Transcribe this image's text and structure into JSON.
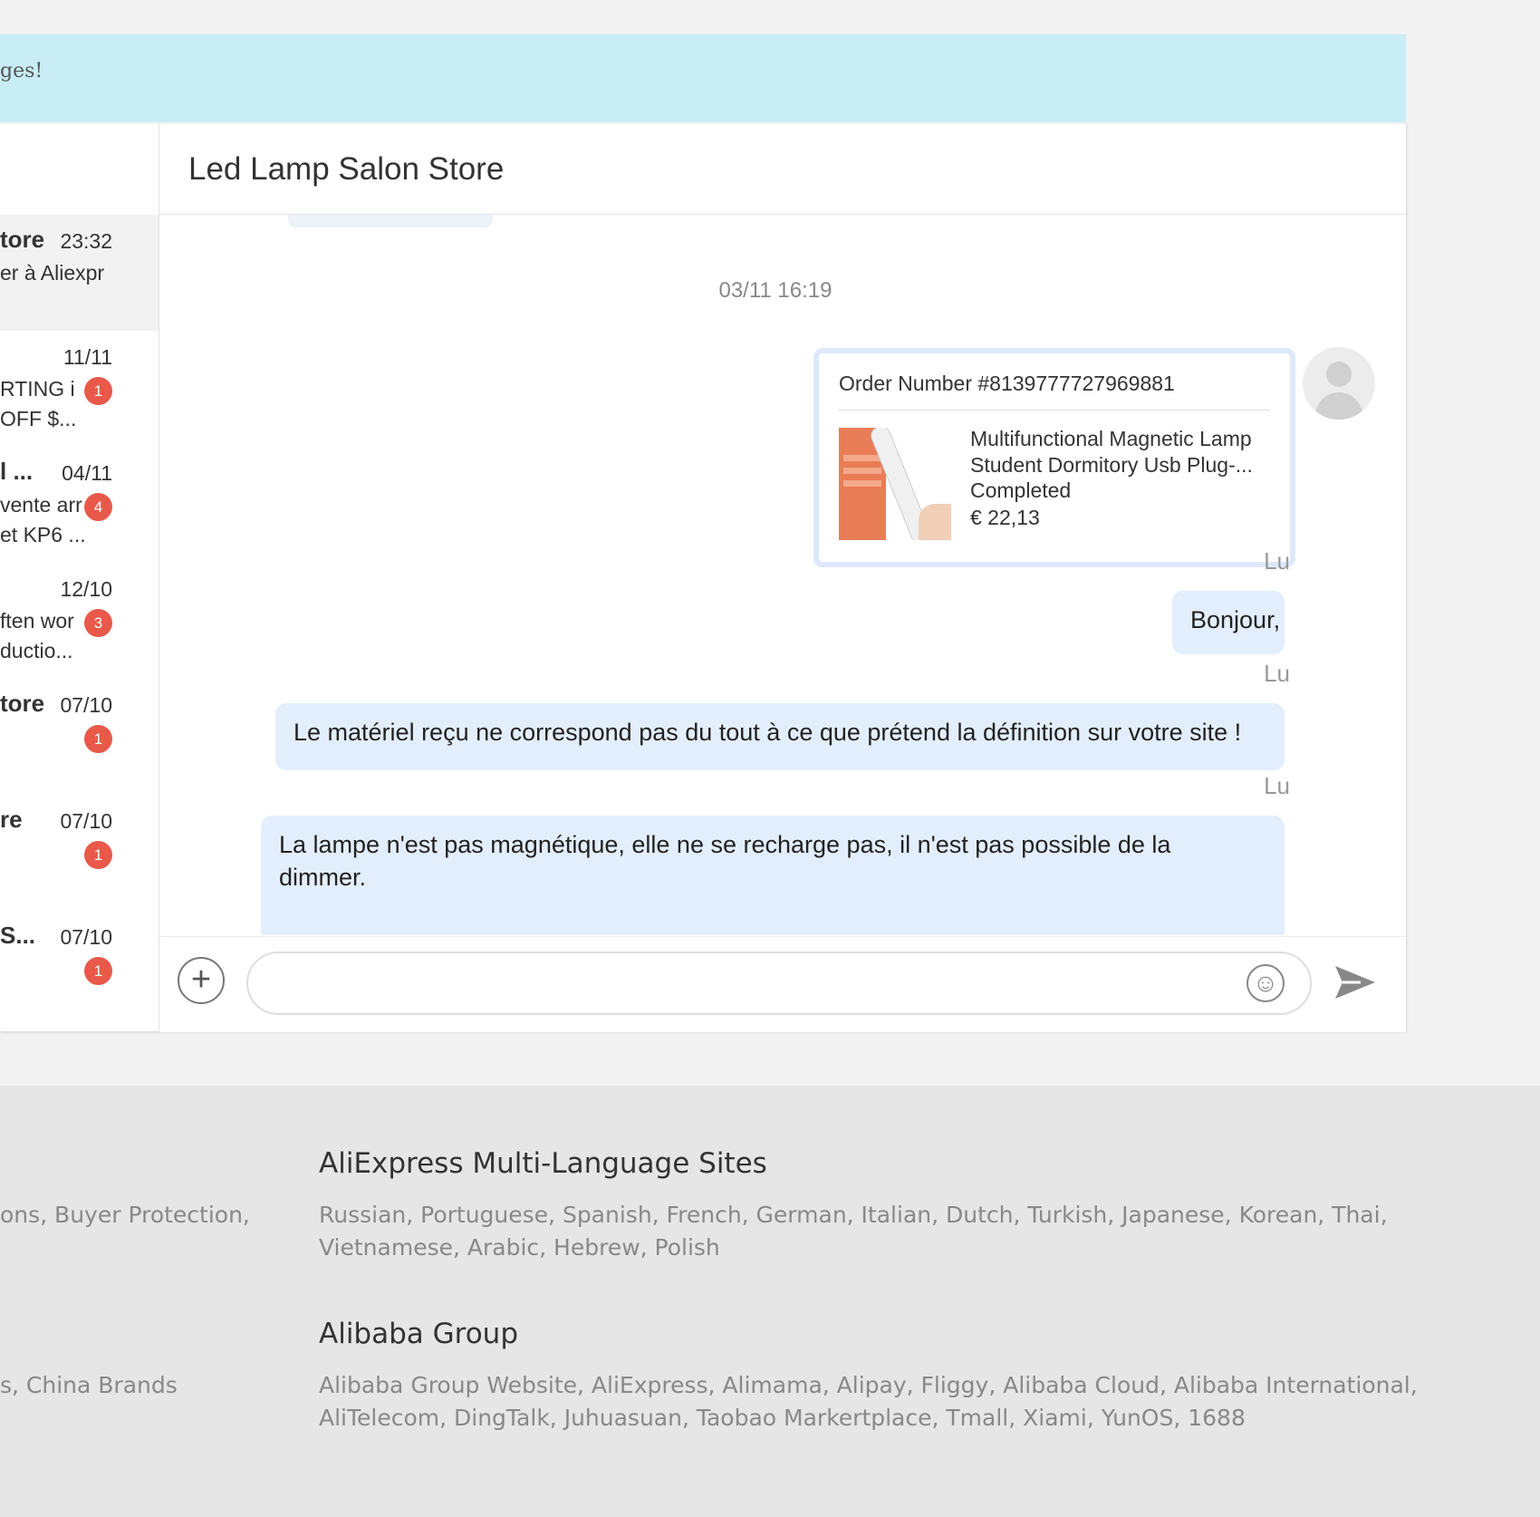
{
  "banner": {
    "text": "ges!"
  },
  "conversations": [
    {
      "name": "tore",
      "time": "23:32",
      "line2": "er à Aliexpr",
      "line3": "",
      "badge": "",
      "active": true
    },
    {
      "name": "",
      "time": "11/11",
      "line2": "RTING i",
      "line3": "OFF $...",
      "badge": "1"
    },
    {
      "name": "l ...",
      "time": "04/11",
      "line2": "vente arr",
      "line3": "et KP6 ...",
      "badge": "4"
    },
    {
      "name": "",
      "time": "12/10",
      "line2": "ften wor",
      "line3": "ductio...",
      "badge": "3"
    },
    {
      "name": "tore",
      "time": "07/10",
      "line2": "",
      "line3": "",
      "badge": "1"
    },
    {
      "name": "re",
      "time": "07/10",
      "line2": "",
      "line3": "",
      "badge": "1"
    },
    {
      "name": "S...",
      "time": "07/10",
      "line2": "",
      "line3": "",
      "badge": "1"
    }
  ],
  "chat": {
    "title": "Led Lamp Salon Store",
    "timestamp": "03/11 16:19",
    "order": {
      "number": "Order Number #8139777727969881",
      "product_line1": "Multifunctional Magnetic Lamp",
      "product_line2": "Student Dormitory Usb Plug-...",
      "status": "Completed",
      "price": "€ 22,13"
    },
    "read_label": "Lu",
    "messages": [
      "Bonjour,",
      "Le matériel reçu ne correspond pas du tout à ce que prétend la définition sur votre site !",
      "La lampe n'est pas magnétique, elle ne se recharge pas, il n'est pas possible de la dimmer."
    ]
  },
  "composer": {
    "placeholder": ""
  },
  "icons": [
    "plus-icon",
    "emoji-icon",
    "send-icon",
    "avatar-icon"
  ],
  "footer": {
    "left_text_1": "ons, Buyer Protection,",
    "left_text_2": "s, China Brands",
    "section1_title": "AliExpress Multi-Language Sites",
    "section1_line1": "Russian, Portuguese, Spanish, French, German, Italian, Dutch, Turkish, Japanese, Korean, Thai,",
    "section1_line2": "Vietnamese, Arabic, Hebrew, Polish",
    "section2_title": "Alibaba Group",
    "section2_line1": "Alibaba Group Website, AliExpress, Alimama, Alipay, Fliggy, Alibaba Cloud, Alibaba International,",
    "section2_line2": "AliTelecom, DingTalk, Juhuasuan, Taobao Markertplace, Tmall, Xiami, YunOS, 1688"
  }
}
